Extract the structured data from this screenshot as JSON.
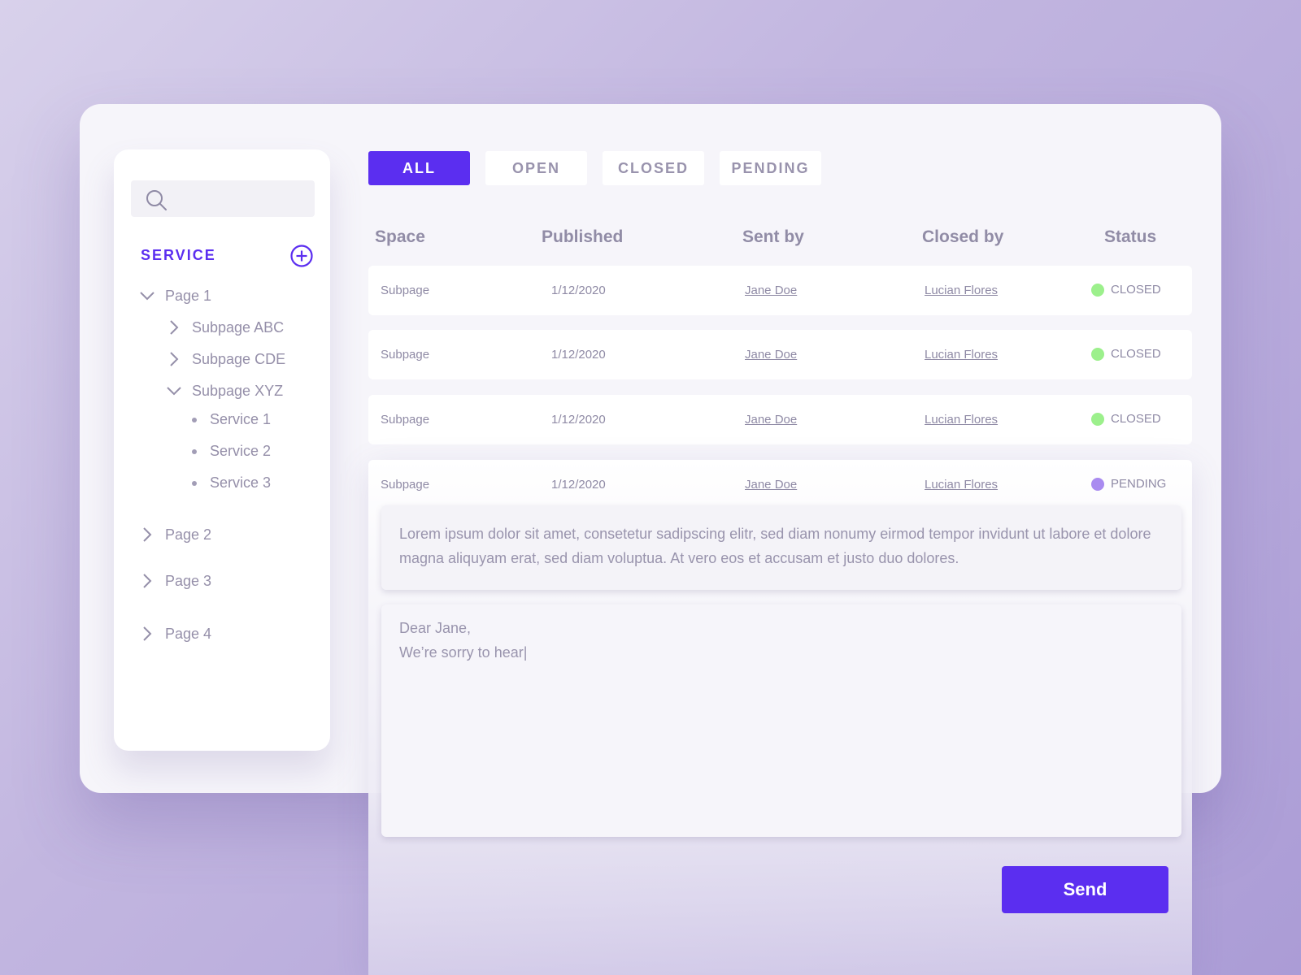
{
  "sidebar": {
    "search": {
      "placeholder": "",
      "icon": "search-icon"
    },
    "section_title": "SERVICE",
    "add_icon": "plus-circle-icon",
    "tree": {
      "page1": "Page 1",
      "subpage_abc": "Subpage ABC",
      "subpage_cde": "Subpage CDE",
      "subpage_xyz": "Subpage XYZ",
      "service1": "Service 1",
      "service2": "Service 2",
      "service3": "Service 3",
      "page2": "Page 2",
      "page3": "Page 3",
      "page4": "Page 4"
    }
  },
  "tabs": {
    "all": "ALL",
    "open": "OPEN",
    "closed": "CLOSED",
    "pending": "PENDING",
    "active": "ALL"
  },
  "table": {
    "headers": {
      "space": "Space",
      "published": "Published",
      "sent_by": "Sent by",
      "closed_by": "Closed by",
      "status": "Status"
    },
    "rows": [
      {
        "space": "Subpage",
        "published": "1/12/2020",
        "sent_by": "Jane Doe",
        "closed_by": "Lucian Flores",
        "status": "CLOSED"
      },
      {
        "space": "Subpage",
        "published": "1/12/2020",
        "sent_by": "Jane Doe",
        "closed_by": "Lucian Flores",
        "status": "CLOSED"
      },
      {
        "space": "Subpage",
        "published": "1/12/2020",
        "sent_by": "Jane Doe",
        "closed_by": "Lucian Flores",
        "status": "CLOSED"
      },
      {
        "space": "Subpage",
        "published": "1/12/2020",
        "sent_by": "Jane Doe",
        "closed_by": "Lucian Flores",
        "status": "PENDING"
      }
    ]
  },
  "expanded": {
    "message": "Lorem ipsum dolor sit amet, consetetur sadipscing elitr, sed diam nonumy eirmod tempor invidunt ut labore et dolore magna aliquyam erat, sed diam voluptua. At vero eos et accusam et justo duo dolores.",
    "reply": "Dear Jane,\nWe’re sorry to hear|",
    "send_label": "Send"
  },
  "colors": {
    "accent": "#5b2ef0",
    "closed": "#9cf08c",
    "pending": "#a98bf0"
  }
}
